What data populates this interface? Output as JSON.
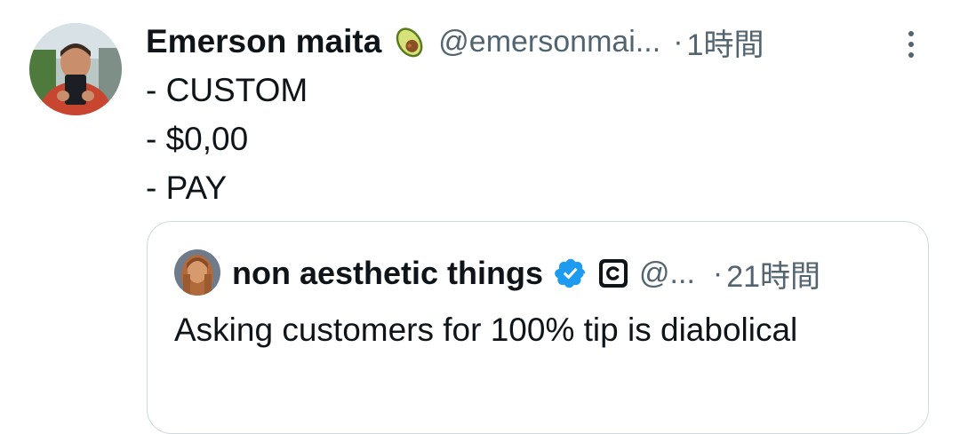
{
  "tweet": {
    "author_name": "Emerson maita",
    "author_handle": "@emersonmai...",
    "separator": "·",
    "time": "1時間",
    "lines": [
      "- CUSTOM",
      "- $0,00",
      "- PAY"
    ]
  },
  "quoted": {
    "author_name": "non aesthetic things",
    "author_handle": "@...",
    "separator": "·",
    "time": "21時間",
    "text": "Asking customers for 100% tip is diabolical"
  },
  "icons": {
    "name_emoji": "avocado-icon",
    "verified": "verified-badge-icon",
    "affiliate": "affiliate-c-icon",
    "more": "more-options-icon"
  },
  "colors": {
    "text_primary": "#0f1419",
    "text_secondary": "#536471",
    "border": "#cfd9de",
    "verified_blue": "#1d9bf0"
  }
}
